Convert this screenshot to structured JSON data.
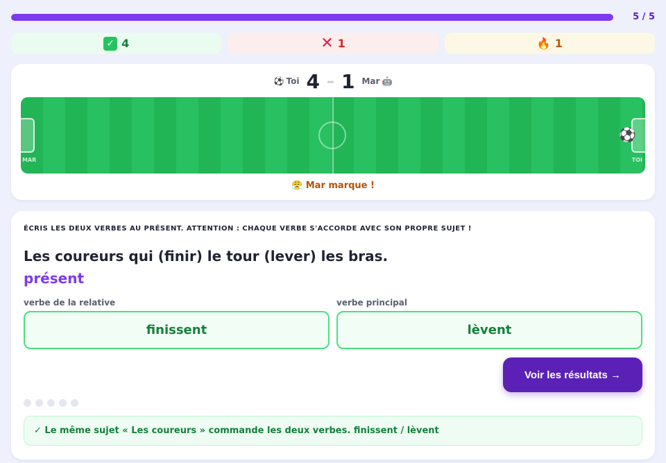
{
  "progress": {
    "value": 1.0,
    "label": "5 / 5"
  },
  "stats": {
    "correct": "4",
    "wrong": "1",
    "streak": "1"
  },
  "match": {
    "player_name": "Toi",
    "opponent_name": "Mar",
    "player_score": "4",
    "opponent_score": "1",
    "left_goal_label": "MAR",
    "right_goal_label": "TOI",
    "event": "😤 Mar marque !"
  },
  "question": {
    "instruction": "ÉCRIS LES DEUX VERBES AU PRÉSENT. ATTENTION : CHAQUE VERBE S'ACCORDE AVEC SON PROPRE SUJET !",
    "sentence": "Les coureurs qui (finir) le tour (lever) les bras.",
    "tense": "présent",
    "field1_label": "verbe de la relative",
    "field1_value": "finissent",
    "field2_label": "verbe principal",
    "field2_value": "lèvent",
    "results_button": "Voir les résultats →",
    "feedback": "✓ Le même sujet « Les coureurs » commande les deux verbes. finissent / lèvent"
  },
  "colors": {
    "accent": "#7c3aed",
    "success": "#15803d",
    "error": "#dc2626"
  },
  "icons": {
    "correct": "check-icon",
    "wrong": "cross-icon",
    "streak": "fire-icon",
    "ball": "soccer-ball-icon",
    "opponent": "robot-icon"
  }
}
